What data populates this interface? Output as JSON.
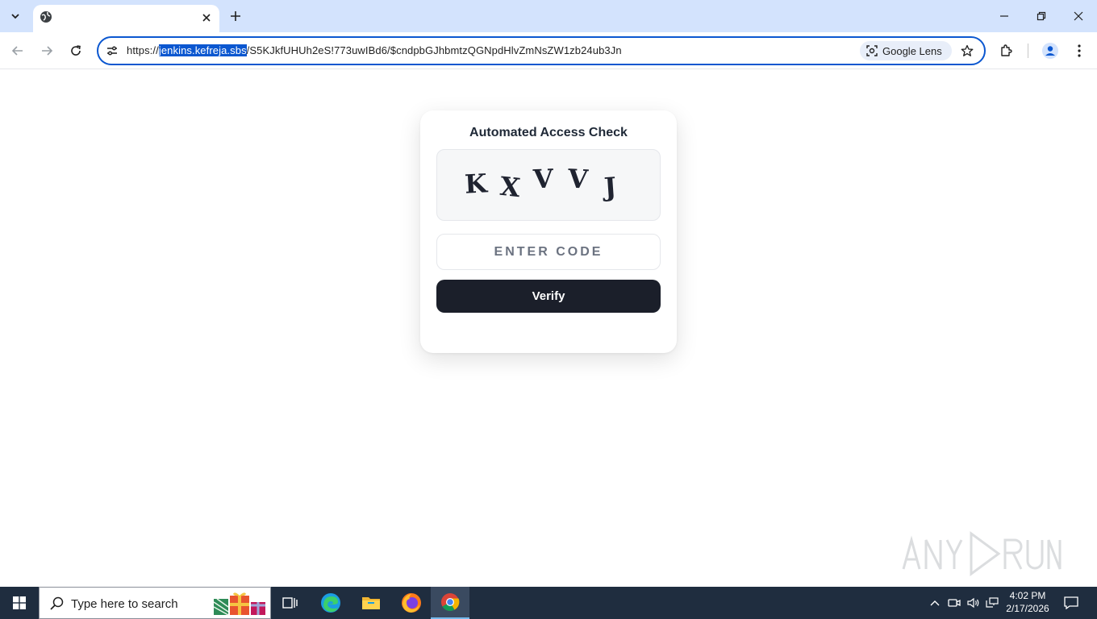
{
  "browser": {
    "url_prefix": "https://",
    "url_host": "jenkins.kefreja.sbs",
    "url_path": "/S5KJkfUHUh2eS!773uwIBd6/$cndpbGJhbmtzQGNpdHlvZmNsZW1zb24ub3Jn",
    "lens_label": "Google Lens"
  },
  "page": {
    "title": "Automated Access Check",
    "captcha_chars": [
      "K",
      "X",
      "V",
      "V",
      "J"
    ],
    "code_placeholder": "ENTER CODE",
    "verify_label": "Verify"
  },
  "watermark": {
    "text": "ANY.RUN"
  },
  "taskbar": {
    "search_placeholder": "Type here to search",
    "time": "4:02 PM",
    "date": "2/17/2026"
  },
  "colors": {
    "tabstrip": "#d3e3fd",
    "accent": "#0b57d0",
    "button": "#1b1f2a",
    "taskbar": "#1f2d3f"
  }
}
